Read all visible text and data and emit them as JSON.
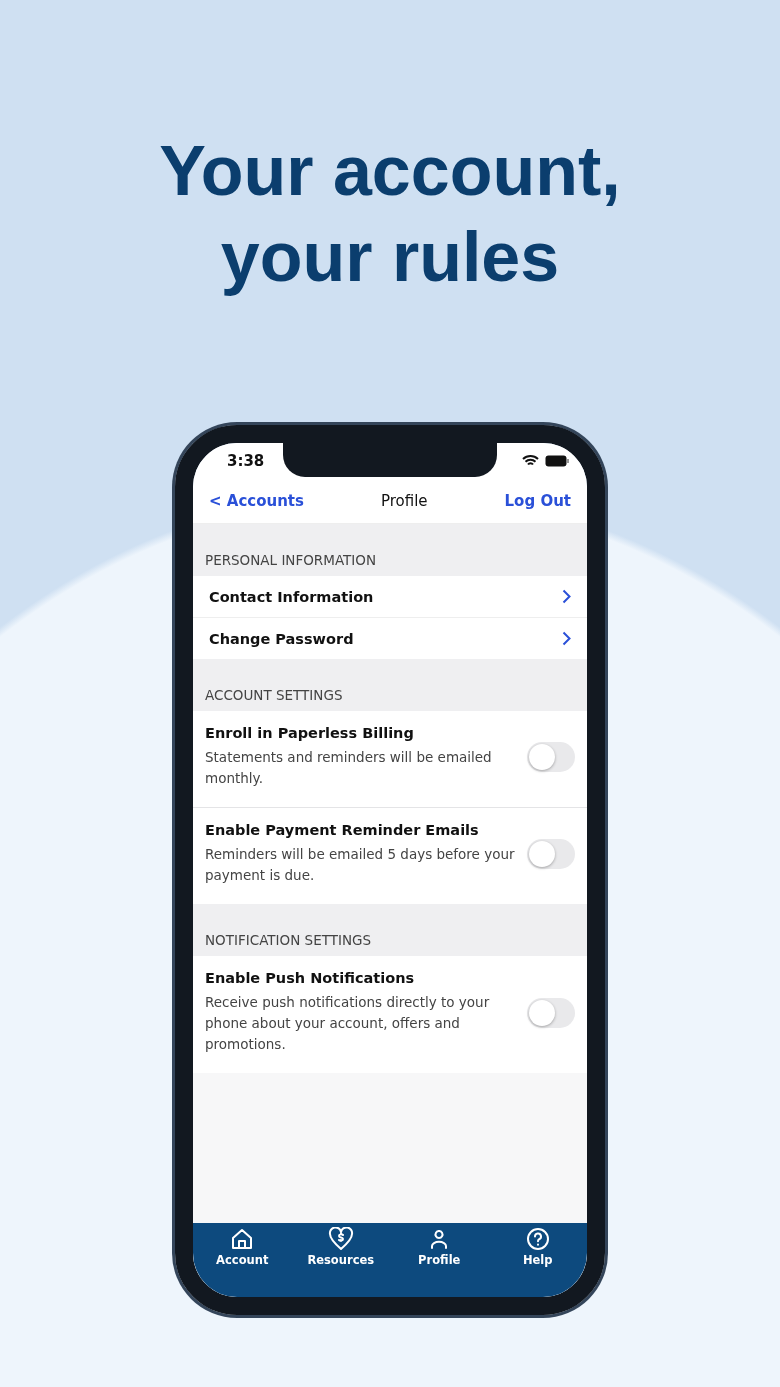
{
  "headline": "Your account,\nyour rules",
  "status_bar": {
    "time": "3:38"
  },
  "nav": {
    "back": "< Accounts",
    "title": "Profile",
    "action": "Log Out"
  },
  "sections": [
    {
      "title": "PERSONAL INFORMATION",
      "items": [
        {
          "kind": "link",
          "label": "Contact Information"
        },
        {
          "kind": "link",
          "label": "Change Password"
        }
      ]
    },
    {
      "title": "ACCOUNT SETTINGS",
      "items": [
        {
          "kind": "toggle",
          "label": "Enroll in Paperless Billing",
          "description": "Statements and reminders will be emailed monthly.",
          "on": false
        },
        {
          "kind": "toggle",
          "label": "Enable Payment Reminder Emails",
          "description": "Reminders will be emailed 5 days before your payment is due.",
          "on": false
        }
      ]
    },
    {
      "title": "NOTIFICATION SETTINGS",
      "items": [
        {
          "kind": "toggle",
          "label": "Enable Push Notifications",
          "description": "Receive push notifications directly to your phone about your account, offers and promotions.",
          "on": false
        }
      ]
    }
  ],
  "tab_bar": [
    {
      "kind": "home",
      "label": "Account"
    },
    {
      "kind": "heart",
      "label": "Resources"
    },
    {
      "kind": "person",
      "label": "Profile"
    },
    {
      "kind": "help",
      "label": "Help"
    }
  ]
}
